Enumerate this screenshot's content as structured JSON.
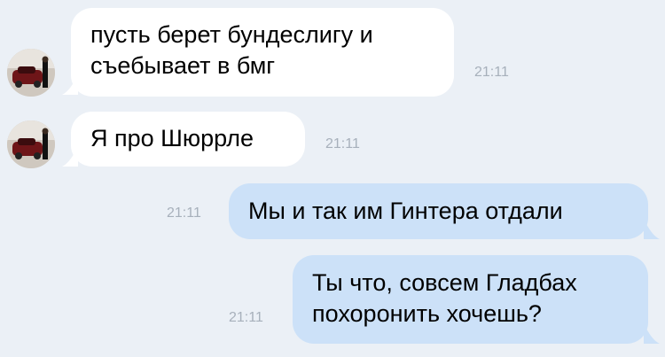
{
  "messages": [
    {
      "direction": "incoming",
      "lines": [
        "пусть берет бундеслигу и",
        "съебывает в бмг"
      ],
      "time": "21:11"
    },
    {
      "direction": "incoming",
      "lines": [
        "Я про Шюррле"
      ],
      "time": "21:11"
    },
    {
      "direction": "outgoing",
      "lines": [
        "Мы и так им Гинтера отдали"
      ],
      "time": "21:11"
    },
    {
      "direction": "outgoing",
      "lines": [
        "Ты что, совсем Гладбах",
        "похоронить хочешь?"
      ],
      "time": "21:11"
    }
  ],
  "colors": {
    "background": "#ebf0f6",
    "incoming_bubble": "#ffffff",
    "outgoing_bubble": "#cce1f8",
    "timestamp": "#a7b0bb"
  }
}
